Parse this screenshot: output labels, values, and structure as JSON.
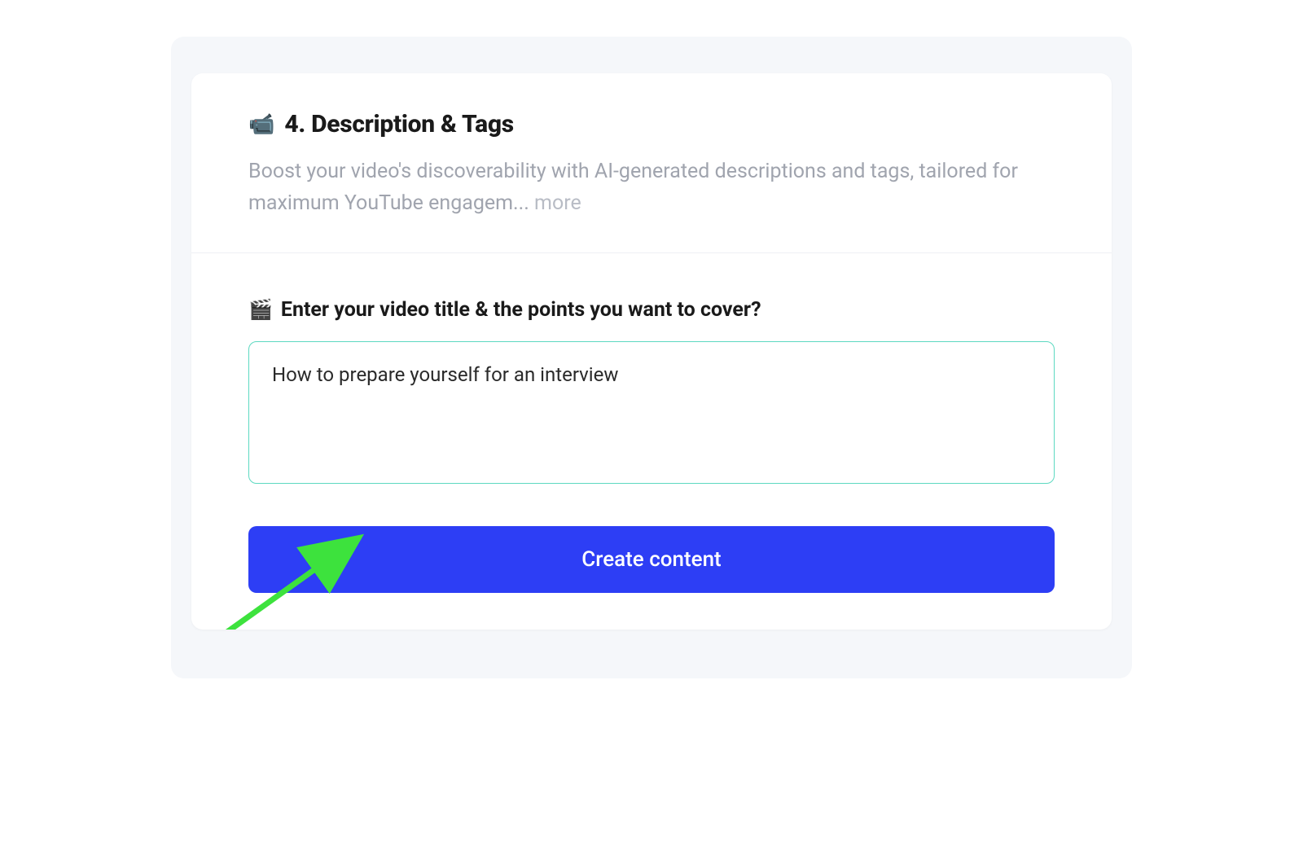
{
  "header": {
    "icon": "📹",
    "title": "4. Description & Tags",
    "subtitle": "Boost your video's discoverability with AI-generated descriptions and tags, tailored for maximum YouTube engagem... ",
    "more_label": "more"
  },
  "form": {
    "label_icon": "🎬",
    "label_text": "Enter your video title & the points you want to cover?",
    "input_value": "How to prepare yourself for an interview",
    "button_label": "Create content"
  },
  "colors": {
    "primary": "#2d3ef5",
    "input_border": "#5dd9c1",
    "arrow": "#3de23d"
  }
}
